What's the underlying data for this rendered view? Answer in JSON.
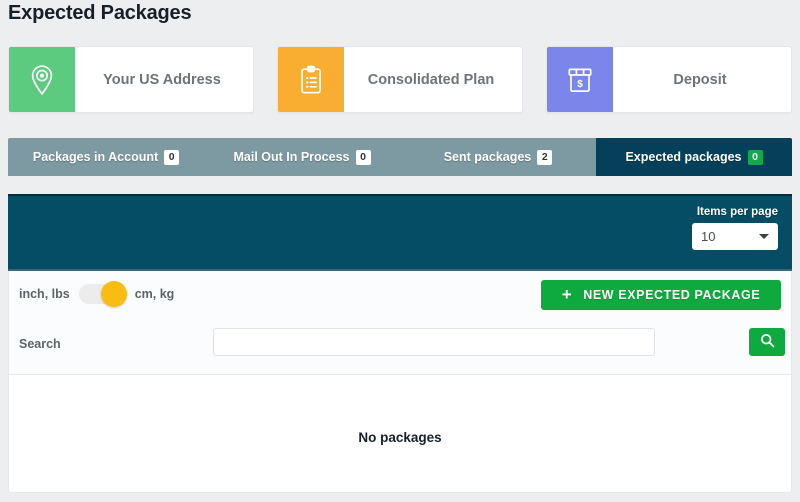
{
  "page": {
    "title": "Expected Packages"
  },
  "cards": [
    {
      "label": "Your US Address",
      "icon": "map-pin-icon",
      "color": "#5ccb7f"
    },
    {
      "label": "Consolidated Plan",
      "icon": "clipboard-icon",
      "color": "#f9ae32"
    },
    {
      "label": "Deposit",
      "icon": "deposit-box-icon",
      "color": "#7a86ea"
    }
  ],
  "tabs": [
    {
      "label": "Packages in Account",
      "count": "0",
      "active": false
    },
    {
      "label": "Mail Out In Process",
      "count": "0",
      "active": false
    },
    {
      "label": "Sent packages",
      "count": "2",
      "active": false
    },
    {
      "label": "Expected packages",
      "count": "0",
      "active": true
    }
  ],
  "toolbar": {
    "items_per_page_label": "Items per page",
    "items_per_page_value": "10",
    "items_per_page_options": [
      "10"
    ],
    "unit_left_label": "inch, lbs",
    "unit_right_label": "cm, kg",
    "unit_toggle_state": "cm, kg",
    "new_package_label": "NEW EXPECTED PACKAGE",
    "new_package_icon": "plus-icon",
    "search_label": "Search",
    "search_value": "",
    "search_placeholder": "",
    "search_button_icon": "search-icon"
  },
  "content": {
    "empty_message": "No packages"
  },
  "colors": {
    "green": "#0eaa3f",
    "navy": "#054d64",
    "tab_bar": "#7d9aa2",
    "toggle_knob": "#f9bc10",
    "badge_active": "#12a84b"
  }
}
